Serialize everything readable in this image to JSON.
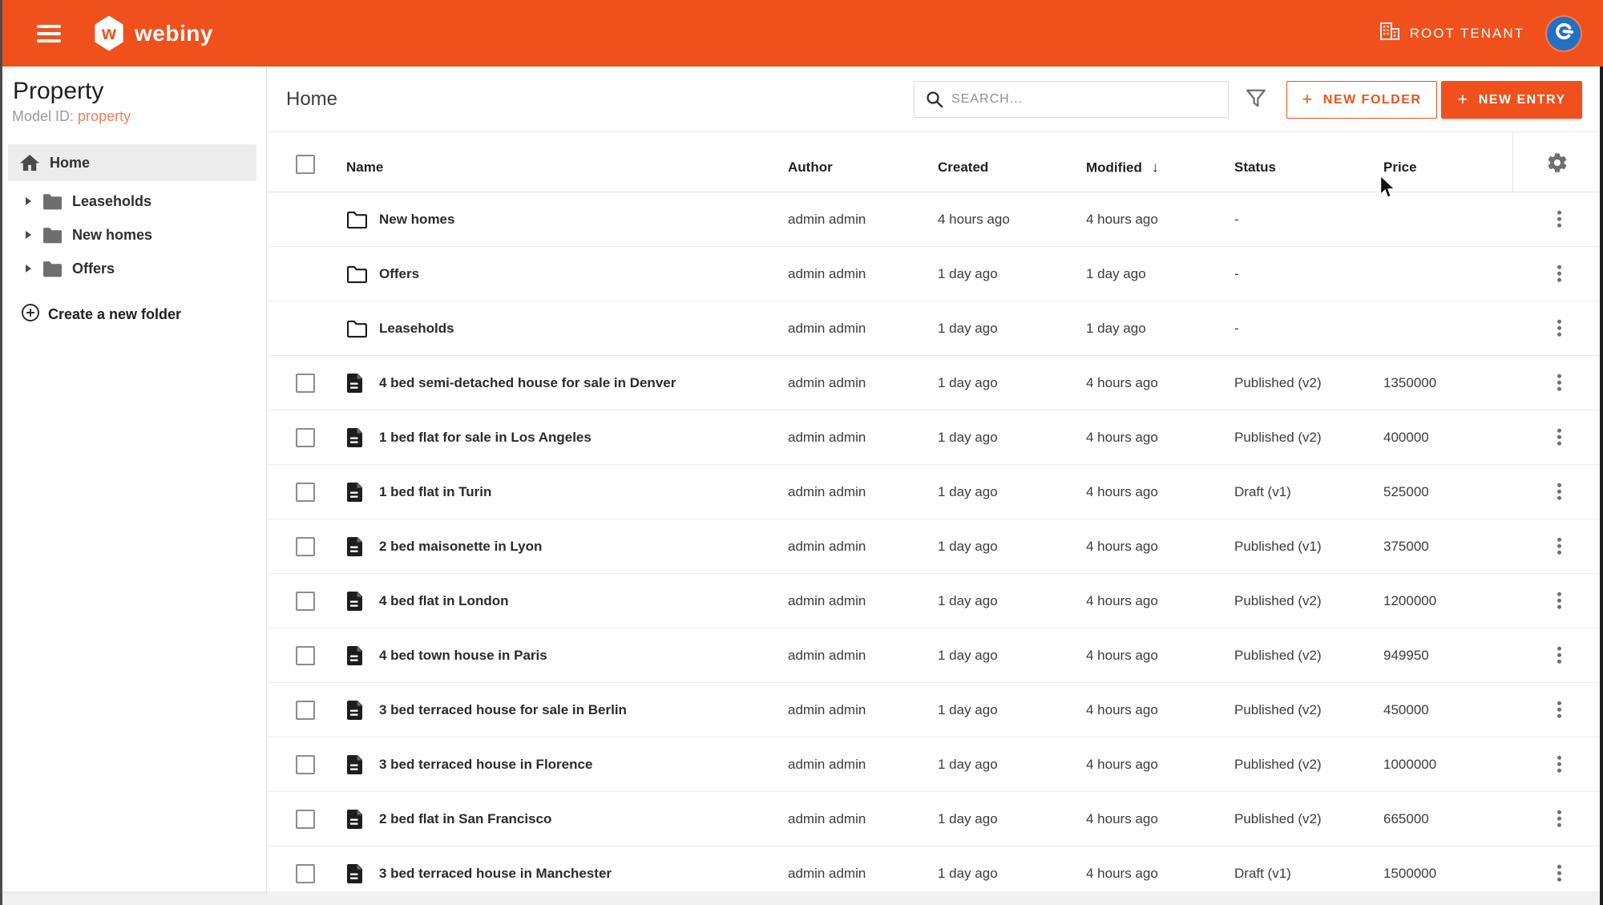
{
  "colors": {
    "accent": "#F0511C",
    "accent_light": "#F37E57",
    "avatar_blue": "#2170C5"
  },
  "topbar": {
    "brand": "webiny",
    "brand_initial": "w",
    "tenant": "ROOT TENANT"
  },
  "sidebar": {
    "title": "Property",
    "model_id_label": "Model ID:",
    "model_id_value": "property",
    "home_label": "Home",
    "folders": [
      {
        "label": "Leaseholds"
      },
      {
        "label": "New homes"
      },
      {
        "label": "Offers"
      }
    ],
    "create_folder_label": "Create a new folder"
  },
  "toolbar": {
    "page_title": "Home",
    "search_placeholder": "SEARCH...",
    "plus": "+",
    "new_folder_label": "NEW FOLDER",
    "new_entry_label": "NEW ENTRY"
  },
  "table": {
    "columns": [
      "Name",
      "Author",
      "Created",
      "Modified",
      "Status",
      "Price"
    ],
    "sort_column": "Modified",
    "sort_arrow": "↓",
    "rows": [
      {
        "type": "folder",
        "name": "New homes",
        "author": "admin admin",
        "created": "4 hours ago",
        "modified": "4 hours ago",
        "status": "-",
        "price": ""
      },
      {
        "type": "folder",
        "name": "Offers",
        "author": "admin admin",
        "created": "1 day ago",
        "modified": "1 day ago",
        "status": "-",
        "price": ""
      },
      {
        "type": "folder",
        "name": "Leaseholds",
        "author": "admin admin",
        "created": "1 day ago",
        "modified": "1 day ago",
        "status": "-",
        "price": ""
      },
      {
        "type": "entry",
        "name": "4 bed semi-detached house for sale in Denver",
        "author": "admin admin",
        "created": "1 day ago",
        "modified": "4 hours ago",
        "status": "Published (v2)",
        "price": "1350000"
      },
      {
        "type": "entry",
        "name": "1 bed flat for sale in Los Angeles",
        "author": "admin admin",
        "created": "1 day ago",
        "modified": "4 hours ago",
        "status": "Published (v2)",
        "price": "400000"
      },
      {
        "type": "entry",
        "name": "1 bed flat in Turin",
        "author": "admin admin",
        "created": "1 day ago",
        "modified": "4 hours ago",
        "status": "Draft (v1)",
        "price": "525000"
      },
      {
        "type": "entry",
        "name": "2 bed maisonette in Lyon",
        "author": "admin admin",
        "created": "1 day ago",
        "modified": "4 hours ago",
        "status": "Published (v1)",
        "price": "375000"
      },
      {
        "type": "entry",
        "name": "4 bed flat in London",
        "author": "admin admin",
        "created": "1 day ago",
        "modified": "4 hours ago",
        "status": "Published (v2)",
        "price": "1200000"
      },
      {
        "type": "entry",
        "name": "4 bed town house in Paris",
        "author": "admin admin",
        "created": "1 day ago",
        "modified": "4 hours ago",
        "status": "Published (v2)",
        "price": "949950"
      },
      {
        "type": "entry",
        "name": "3 bed terraced house for sale in Berlin",
        "author": "admin admin",
        "created": "1 day ago",
        "modified": "4 hours ago",
        "status": "Published (v2)",
        "price": "450000"
      },
      {
        "type": "entry",
        "name": "3 bed terraced house in Florence",
        "author": "admin admin",
        "created": "1 day ago",
        "modified": "4 hours ago",
        "status": "Published (v2)",
        "price": "1000000"
      },
      {
        "type": "entry",
        "name": "2 bed flat in San Francisco",
        "author": "admin admin",
        "created": "1 day ago",
        "modified": "4 hours ago",
        "status": "Published (v2)",
        "price": "665000"
      },
      {
        "type": "entry",
        "name": "3 bed terraced house in Manchester",
        "author": "admin admin",
        "created": "1 day ago",
        "modified": "4 hours ago",
        "status": "Draft (v1)",
        "price": "1500000"
      }
    ]
  }
}
